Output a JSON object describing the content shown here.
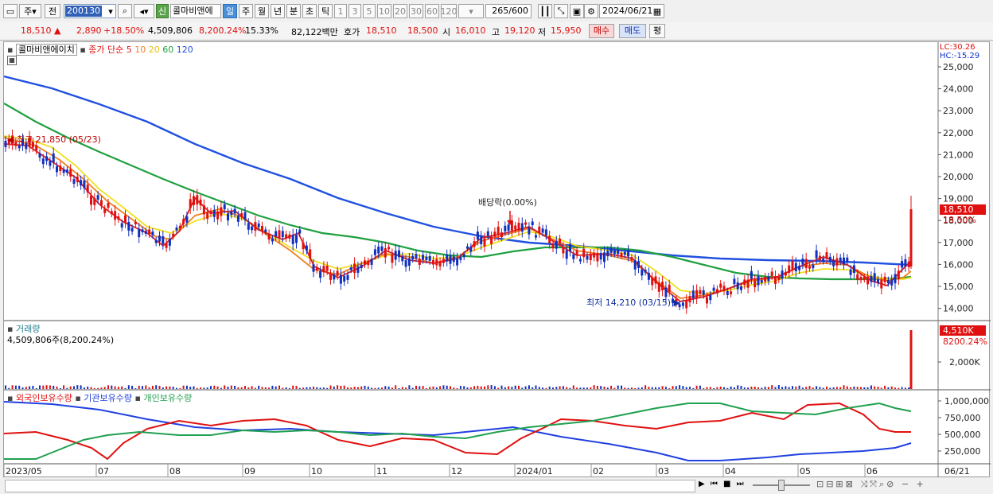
{
  "toolbar": {
    "type_label": "주",
    "prev_label": "전",
    "stock_code": "200130",
    "new_badge": "신",
    "stock_name": "콜마비앤에",
    "periods": [
      "일",
      "주",
      "월",
      "년",
      "분",
      "초",
      "틱"
    ],
    "active_period": "일",
    "intervals": [
      "1",
      "3",
      "5",
      "10",
      "20",
      "30",
      "60",
      "120"
    ],
    "bar_count": "265",
    "bar_total": "/600",
    "date": "2024/06/21"
  },
  "quote": {
    "price": "18,510",
    "arrow": "▲",
    "change": "2,890",
    "change_pct": "+18.50%",
    "volume": "4,509,806",
    "volume_pct": "8,200.24%",
    "turnover_pct": "15.33%",
    "amount": "82,122백만",
    "bid_label": "호가",
    "ask_price": "18,510",
    "bid_price": "18,500",
    "open_label": "시",
    "open": "16,010",
    "high_label": "고",
    "high": "19,120",
    "low_label": "저",
    "low": "15,950",
    "buy_button": "매수",
    "sell_button": "매도",
    "eval_button": "평"
  },
  "price_panel": {
    "stock_label": "콜마비앤에이치",
    "ma_label": "종가 단순",
    "ma_periods": [
      "5",
      "10",
      "20",
      "60",
      "120"
    ],
    "ma_colors": [
      "#e02020",
      "#f08020",
      "#f0e020",
      "#20a040",
      "#2050e0"
    ],
    "lc_label": "LC:30.26",
    "hc_label": "HC:-15.29",
    "y_ticks": [
      "25,000",
      "24,000",
      "23,000",
      "22,000",
      "21,000",
      "20,000",
      "19,000",
      "18,000",
      "17,000",
      "16,000",
      "15,000",
      "14,000"
    ],
    "high_annotation": "최고 21,850 (05/23)",
    "dividend_annotation": "배당락(0.00%)",
    "low_annotation": "최저 14,210 (03/15)",
    "price_tag": "18,510",
    "price_pct_tag": "18.50%"
  },
  "volume_panel": {
    "title": "거래량",
    "value": "4,509,806주(8,200.24%)",
    "tag": "4,510K",
    "tag_pct": "8200.24%",
    "y_tick": "2,000K"
  },
  "holding_panel": {
    "series": [
      "외국인보유수량",
      "기관보유수량",
      "개인보유수량"
    ],
    "series_colors": [
      "#e01010",
      "#2040e0",
      "#20a050"
    ],
    "y_ticks": [
      "1,000,000",
      "750,000",
      "500,000",
      "250,000"
    ]
  },
  "x_axis": {
    "labels": [
      "2023/05",
      "07",
      "08",
      "09",
      "10",
      "11",
      "12",
      "2024/01",
      "02",
      "03",
      "04",
      "05",
      "06"
    ],
    "end_label": "06/21"
  }
}
